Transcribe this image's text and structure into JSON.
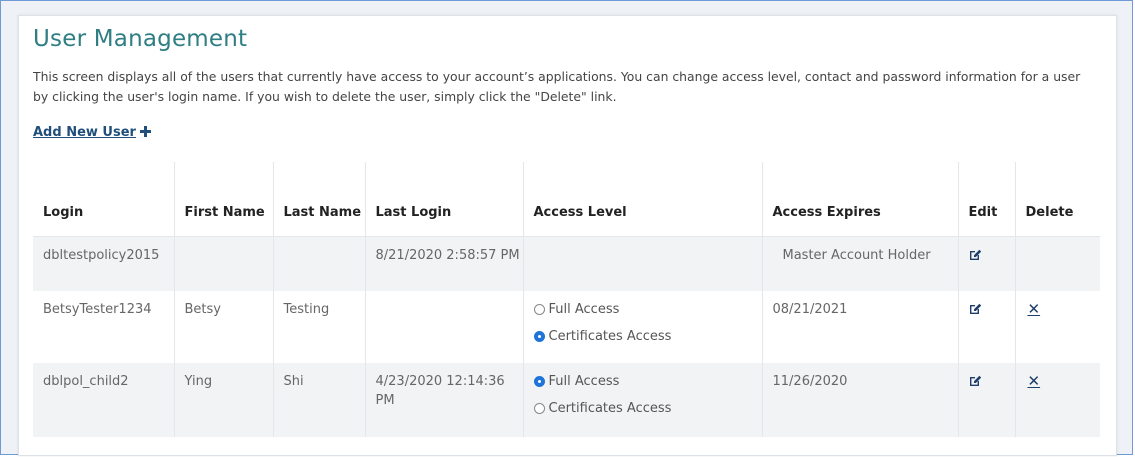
{
  "page": {
    "title": "User Management",
    "description": "This screen displays all of the users that currently have access to your account’s applications. You can change access level, contact and password information for a user by clicking the user's login name. If you wish to delete the user, simply click the \"Delete\" link.",
    "add_user_label": "Add New User"
  },
  "table": {
    "headers": {
      "login": "Login",
      "first_name": "First Name",
      "last_name": "Last Name",
      "last_login": "Last Login",
      "access_level": "Access Level",
      "access_expires": "Access Expires",
      "edit": "Edit",
      "delete": "Delete"
    },
    "rows": [
      {
        "login": "dbltestpolicy2015",
        "first_name": "",
        "last_name": "",
        "last_login": "8/21/2020 2:58:57 PM",
        "access_expires": "Master Account Holder",
        "access_options": [],
        "deletable": false
      },
      {
        "login": "BetsyTester1234",
        "first_name": "Betsy",
        "last_name": "Testing",
        "last_login": "",
        "access_expires": "08/21/2021",
        "access_options": [
          {
            "label": "Full Access",
            "checked": false
          },
          {
            "label": "Certificates Access",
            "checked": true
          }
        ],
        "deletable": true
      },
      {
        "login": "dblpol_child2",
        "first_name": "Ying",
        "last_name": "Shi",
        "last_login": "4/23/2020 12:14:36 PM",
        "access_expires": "11/26/2020",
        "access_options": [
          {
            "label": "Full Access",
            "checked": true
          },
          {
            "label": "Certificates Access",
            "checked": false
          }
        ],
        "deletable": true
      }
    ],
    "delete_glyph": "✕"
  },
  "colors": {
    "title": "#2e7e84",
    "link": "#1f4f7a",
    "expires_date": "#3e8a3e",
    "radio_checked": "#1e74d8",
    "row_shaded": "#f2f3f5"
  },
  "icons": {
    "add": "plus-icon",
    "edit": "edit-icon",
    "delete": "close-icon"
  }
}
